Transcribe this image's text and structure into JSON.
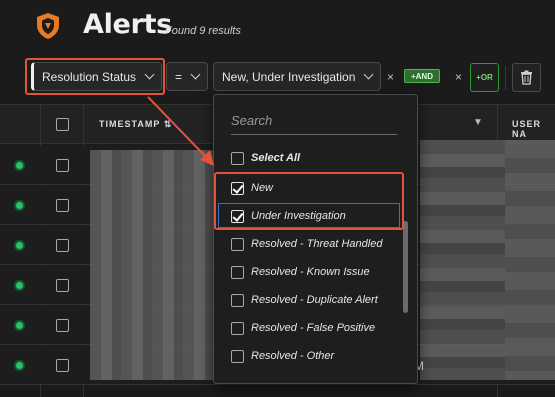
{
  "header": {
    "title": "Alerts",
    "results": "Found 9 results"
  },
  "filter": {
    "field": "Resolution Status",
    "operator": "=",
    "value": "New, Under Investigation",
    "remove": "×",
    "and_label": "+AND",
    "or_label": "+OR"
  },
  "table": {
    "columns": [
      "TIMESTAMP",
      "USER NA"
    ],
    "rows": 6,
    "partial_text": "M"
  },
  "dropdown": {
    "search_placeholder": "Search",
    "select_all": "Select All",
    "options": [
      {
        "label": "New",
        "checked": true
      },
      {
        "label": "Under Investigation",
        "checked": true
      },
      {
        "label": "Resolved - Threat Handled",
        "checked": false
      },
      {
        "label": "Resolved - Known Issue",
        "checked": false
      },
      {
        "label": "Resolved - Duplicate Alert",
        "checked": false
      },
      {
        "label": "Resolved - False Positive",
        "checked": false
      },
      {
        "label": "Resolved - Other",
        "checked": false
      }
    ]
  },
  "colors": {
    "accent": "#e2533a",
    "status_new": "#2bbf6a",
    "or_green": "#2e9a2e"
  }
}
